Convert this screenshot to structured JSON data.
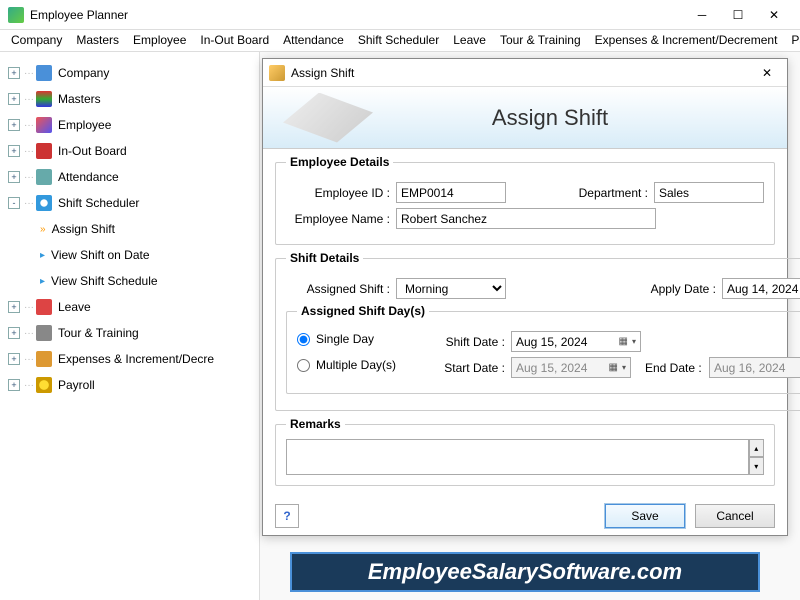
{
  "window": {
    "title": "Employee Planner"
  },
  "menu": [
    "Company",
    "Masters",
    "Employee",
    "In-Out Board",
    "Attendance",
    "Shift Scheduler",
    "Leave",
    "Tour & Training",
    "Expenses & Increment/Decrement",
    "Payroll"
  ],
  "tree": {
    "company": "Company",
    "masters": "Masters",
    "employee": "Employee",
    "inout": "In-Out Board",
    "attendance": "Attendance",
    "shift": "Shift Scheduler",
    "leave": "Leave",
    "tour": "Tour & Training",
    "expenses": "Expenses & Increment/Decre",
    "payroll": "Payroll",
    "shift_children": {
      "assign": "Assign Shift",
      "viewdate": "View Shift on Date",
      "viewsched": "View Shift Schedule"
    }
  },
  "dialog": {
    "title": "Assign Shift",
    "banner": "Assign Shift",
    "emp_details": {
      "legend": "Employee Details",
      "id_lbl": "Employee ID :",
      "id": "EMP0014",
      "dept_lbl": "Department :",
      "dept": "Sales",
      "name_lbl": "Employee Name :",
      "name": "Robert Sanchez"
    },
    "shift_details": {
      "legend": "Shift Details",
      "assigned_lbl": "Assigned Shift :",
      "assigned": "Morning",
      "apply_lbl": "Apply Date :",
      "apply": "Aug 14, 2024",
      "days_legend": "Assigned Shift Day(s)",
      "single": "Single Day",
      "multiple": "Multiple Day(s)",
      "shiftdate_lbl": "Shift Date :",
      "shiftdate": "Aug 15, 2024",
      "start_lbl": "Start Date :",
      "start": "Aug 15, 2024",
      "end_lbl": "End Date :",
      "end": "Aug 16, 2024"
    },
    "remarks": {
      "legend": "Remarks",
      "value": ""
    },
    "buttons": {
      "save": "Save",
      "cancel": "Cancel"
    }
  },
  "watermark": "EmployeeSalarySoftware.com"
}
